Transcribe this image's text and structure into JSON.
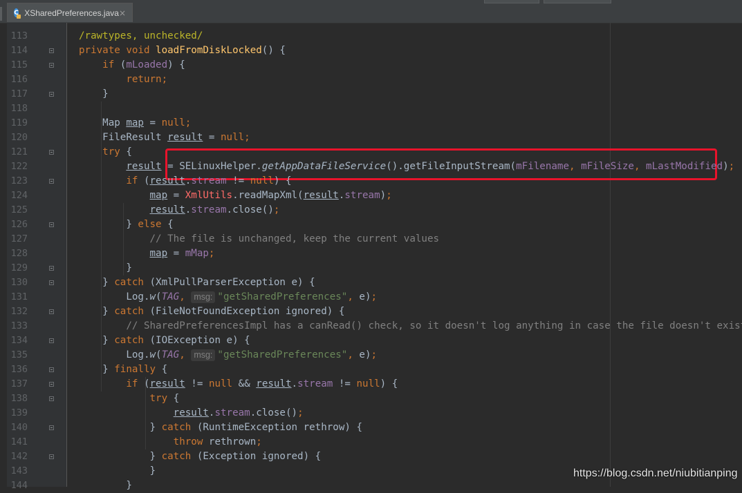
{
  "tab": {
    "title": "XSharedPreferences.java",
    "icon": "java-class-icon",
    "close": "×"
  },
  "colors": {
    "background": "#2b2b2b",
    "gutter": "#313335",
    "keyword": "#cc7832",
    "method": "#ffc66d",
    "field": "#9876aa",
    "string": "#6a8759",
    "comment": "#808080",
    "highlight": "#e8132b"
  },
  "lines": [
    {
      "n": "113",
      "tokens": [
        {
          "t": "/rawtypes, unchecked/",
          "c": "anno"
        }
      ]
    },
    {
      "n": "114",
      "tokens": [
        {
          "t": "private void ",
          "c": "k"
        },
        {
          "t": "loadFromDiskLocked",
          "c": "f"
        },
        {
          "t": "() {"
        }
      ]
    },
    {
      "n": "115",
      "tokens": [
        {
          "t": "    "
        },
        {
          "t": "if ",
          "c": "k"
        },
        {
          "t": "("
        },
        {
          "t": "mLoaded",
          "c": "v"
        },
        {
          "t": ") {"
        }
      ]
    },
    {
      "n": "116",
      "tokens": [
        {
          "t": "        "
        },
        {
          "t": "return;",
          "c": "k"
        }
      ]
    },
    {
      "n": "117",
      "tokens": [
        {
          "t": "    }"
        }
      ]
    },
    {
      "n": "118",
      "tokens": []
    },
    {
      "n": "119",
      "tokens": [
        {
          "t": "    Map "
        },
        {
          "t": "map",
          "c": "u"
        },
        {
          "t": " = "
        },
        {
          "t": "null;",
          "c": "k"
        }
      ]
    },
    {
      "n": "120",
      "tokens": [
        {
          "t": "    FileResult "
        },
        {
          "t": "result",
          "c": "u"
        },
        {
          "t": " = "
        },
        {
          "t": "null;",
          "c": "k"
        }
      ]
    },
    {
      "n": "121",
      "tokens": [
        {
          "t": "    "
        },
        {
          "t": "try ",
          "c": "k"
        },
        {
          "t": "{"
        }
      ]
    },
    {
      "n": "122",
      "tokens": [
        {
          "t": "        "
        },
        {
          "t": "result",
          "c": "u"
        },
        {
          "t": " = SELinuxHelper."
        },
        {
          "t": "getAppDataFileService",
          "c": "i"
        },
        {
          "t": "().getFileInputStream("
        },
        {
          "t": "mFilename",
          "c": "v"
        },
        {
          "t": ", ",
          "c": "k"
        },
        {
          "t": "mFileSize",
          "c": "v"
        },
        {
          "t": ", ",
          "c": "k"
        },
        {
          "t": "mLastModified",
          "c": "v"
        },
        {
          "t": ")"
        },
        {
          "t": ";",
          "c": "k"
        }
      ]
    },
    {
      "n": "123",
      "tokens": [
        {
          "t": "        "
        },
        {
          "t": "if ",
          "c": "k"
        },
        {
          "t": "("
        },
        {
          "t": "result",
          "c": "u"
        },
        {
          "t": "."
        },
        {
          "t": "stream",
          "c": "v"
        },
        {
          "t": " != "
        },
        {
          "t": "null",
          "c": "k"
        },
        {
          "t": ") {"
        }
      ]
    },
    {
      "n": "124",
      "tokens": [
        {
          "t": "            "
        },
        {
          "t": "map",
          "c": "u"
        },
        {
          "t": " = "
        },
        {
          "t": "XmlUtils",
          "c": "cls"
        },
        {
          "t": ".readMapXml("
        },
        {
          "t": "result",
          "c": "u"
        },
        {
          "t": "."
        },
        {
          "t": "stream",
          "c": "v"
        },
        {
          "t": ")"
        },
        {
          "t": ";",
          "c": "k"
        }
      ]
    },
    {
      "n": "125",
      "tokens": [
        {
          "t": "            "
        },
        {
          "t": "result",
          "c": "u"
        },
        {
          "t": "."
        },
        {
          "t": "stream",
          "c": "v"
        },
        {
          "t": ".close()"
        },
        {
          "t": ";",
          "c": "k"
        }
      ]
    },
    {
      "n": "126",
      "tokens": [
        {
          "t": "        } "
        },
        {
          "t": "else ",
          "c": "k"
        },
        {
          "t": "{"
        }
      ]
    },
    {
      "n": "127",
      "tokens": [
        {
          "t": "            "
        },
        {
          "t": "// The file is unchanged, keep the current values",
          "c": "c"
        }
      ]
    },
    {
      "n": "128",
      "tokens": [
        {
          "t": "            "
        },
        {
          "t": "map",
          "c": "u"
        },
        {
          "t": " = "
        },
        {
          "t": "mMap",
          "c": "v"
        },
        {
          "t": ";",
          "c": "k"
        }
      ]
    },
    {
      "n": "129",
      "tokens": [
        {
          "t": "        }"
        }
      ]
    },
    {
      "n": "130",
      "tokens": [
        {
          "t": "    } "
        },
        {
          "t": "catch ",
          "c": "k"
        },
        {
          "t": "(XmlPullParserException e) {"
        }
      ]
    },
    {
      "n": "131",
      "tokens": [
        {
          "t": "        Log."
        },
        {
          "t": "w",
          "c": "i"
        },
        {
          "t": "("
        },
        {
          "t": "TAG",
          "c": "vi"
        },
        {
          "t": ", ",
          "c": "k"
        },
        {
          "t": "msg:",
          "hint": true
        },
        {
          "t": "\"getSharedPreferences\"",
          "c": "s"
        },
        {
          "t": ", ",
          "c": "k"
        },
        {
          "t": "e)"
        },
        {
          "t": ";",
          "c": "k"
        }
      ]
    },
    {
      "n": "132",
      "tokens": [
        {
          "t": "    } "
        },
        {
          "t": "catch ",
          "c": "k"
        },
        {
          "t": "(FileNotFoundException ignored) {"
        }
      ]
    },
    {
      "n": "133",
      "tokens": [
        {
          "t": "        "
        },
        {
          "t": "// SharedPreferencesImpl has a canRead() check, so it doesn't log anything in case the file doesn't exist",
          "c": "c"
        }
      ]
    },
    {
      "n": "134",
      "tokens": [
        {
          "t": "    } "
        },
        {
          "t": "catch ",
          "c": "k"
        },
        {
          "t": "(IOException e) {"
        }
      ]
    },
    {
      "n": "135",
      "tokens": [
        {
          "t": "        Log."
        },
        {
          "t": "w",
          "c": "i"
        },
        {
          "t": "("
        },
        {
          "t": "TAG",
          "c": "vi"
        },
        {
          "t": ", ",
          "c": "k"
        },
        {
          "t": "msg:",
          "hint": true
        },
        {
          "t": "\"getSharedPreferences\"",
          "c": "s"
        },
        {
          "t": ", ",
          "c": "k"
        },
        {
          "t": "e)"
        },
        {
          "t": ";",
          "c": "k"
        }
      ]
    },
    {
      "n": "136",
      "tokens": [
        {
          "t": "    } "
        },
        {
          "t": "finally ",
          "c": "k"
        },
        {
          "t": "{"
        }
      ]
    },
    {
      "n": "137",
      "tokens": [
        {
          "t": "        "
        },
        {
          "t": "if ",
          "c": "k"
        },
        {
          "t": "("
        },
        {
          "t": "result",
          "c": "u"
        },
        {
          "t": " != "
        },
        {
          "t": "null ",
          "c": "k"
        },
        {
          "t": "&& "
        },
        {
          "t": "result",
          "c": "u"
        },
        {
          "t": "."
        },
        {
          "t": "stream",
          "c": "v"
        },
        {
          "t": " != "
        },
        {
          "t": "null",
          "c": "k"
        },
        {
          "t": ") {"
        }
      ]
    },
    {
      "n": "138",
      "tokens": [
        {
          "t": "            "
        },
        {
          "t": "try ",
          "c": "k"
        },
        {
          "t": "{"
        }
      ]
    },
    {
      "n": "139",
      "tokens": [
        {
          "t": "                "
        },
        {
          "t": "result",
          "c": "u"
        },
        {
          "t": "."
        },
        {
          "t": "stream",
          "c": "v"
        },
        {
          "t": ".close()"
        },
        {
          "t": ";",
          "c": "k"
        }
      ]
    },
    {
      "n": "140",
      "tokens": [
        {
          "t": "            } "
        },
        {
          "t": "catch ",
          "c": "k"
        },
        {
          "t": "(RuntimeException rethrow) {"
        }
      ]
    },
    {
      "n": "141",
      "tokens": [
        {
          "t": "                "
        },
        {
          "t": "throw ",
          "c": "k"
        },
        {
          "t": "rethrown"
        },
        {
          "t": ";",
          "c": "k"
        }
      ]
    },
    {
      "n": "142",
      "tokens": [
        {
          "t": "            } "
        },
        {
          "t": "catch ",
          "c": "k"
        },
        {
          "t": "(Exception ignored) {"
        }
      ]
    },
    {
      "n": "143",
      "tokens": [
        {
          "t": "            }"
        }
      ]
    },
    {
      "n": "144",
      "tokens": [
        {
          "t": "        }"
        }
      ]
    }
  ],
  "fold_markers": [
    "114",
    "115",
    "117",
    "121",
    "123",
    "126",
    "129",
    "130",
    "132",
    "134",
    "136",
    "137",
    "138",
    "140",
    "142"
  ],
  "watermark": "https://blog.csdn.net/niubitianping"
}
